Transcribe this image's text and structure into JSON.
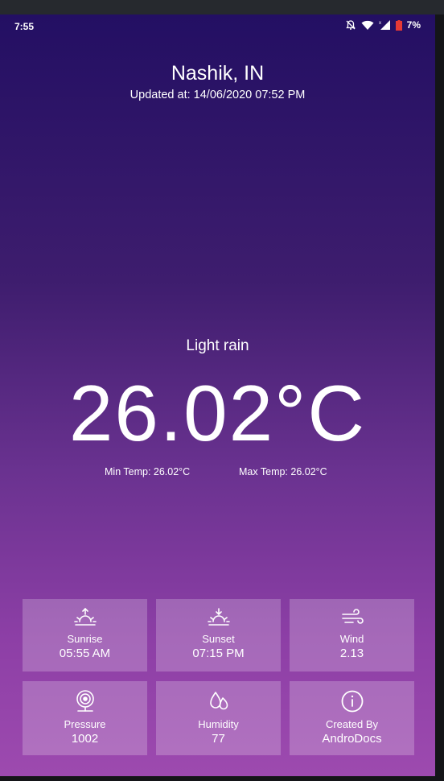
{
  "status_bar": {
    "time": "7:55",
    "battery": "7%",
    "icons": [
      "mute-icon",
      "wifi-icon",
      "signal-icon",
      "battery-icon"
    ]
  },
  "location": {
    "city": "Nashik, IN",
    "updated": "Updated at: 14/06/2020 07:52 PM"
  },
  "weather": {
    "status": "Light rain",
    "temp": "26.02°C",
    "min_temp": "Min Temp: 26.02°C",
    "max_temp": "Max Temp: 26.02°C"
  },
  "details": {
    "sunrise": {
      "label": "Sunrise",
      "value": "05:55 AM",
      "icon": "sunrise-icon"
    },
    "sunset": {
      "label": "Sunset",
      "value": "07:15 PM",
      "icon": "sunset-icon"
    },
    "wind": {
      "label": "Wind",
      "value": "2.13",
      "icon": "wind-icon"
    },
    "pressure": {
      "label": "Pressure",
      "value": "1002",
      "icon": "pressure-icon"
    },
    "humidity": {
      "label": "Humidity",
      "value": "77",
      "icon": "humidity-icon"
    },
    "created_by": {
      "label": "Created By",
      "value": "AndroDocs",
      "icon": "info-icon"
    }
  },
  "colors": {
    "gradient_top": "#230f63",
    "gradient_bottom": "#9d4aaf",
    "text": "#ffffff",
    "battery_low": "#e53935"
  }
}
